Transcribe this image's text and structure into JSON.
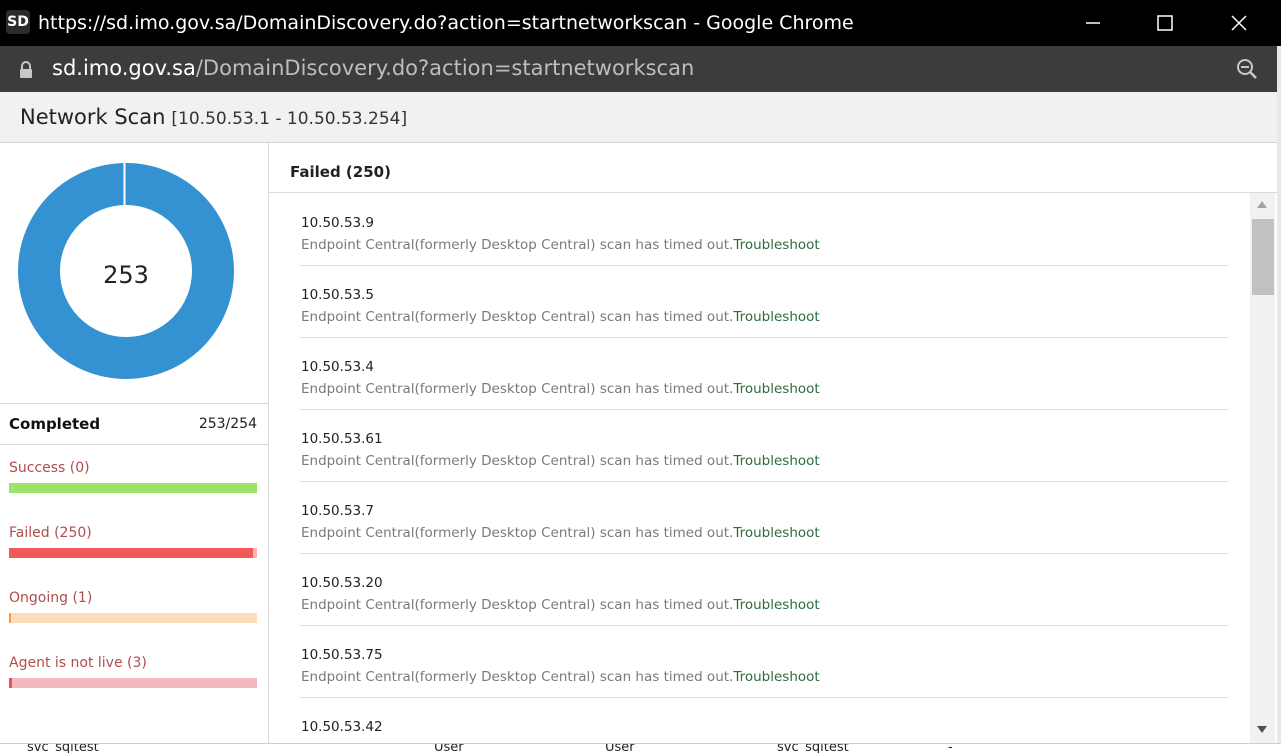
{
  "window": {
    "app_icon_text": "SD",
    "title": "https://sd.imo.gov.sa/DomainDiscovery.do?action=startnetworkscan - Google Chrome"
  },
  "address_bar": {
    "domain": "sd.imo.gov.sa",
    "path": "/DomainDiscovery.do?action=startnetworkscan"
  },
  "dialog": {
    "title": "Network Scan",
    "range": "[10.50.53.1 - 10.50.53.254]"
  },
  "summary": {
    "donut_total": "253",
    "completed_label": "Completed",
    "completed_value": "253/254",
    "stats": [
      {
        "label": "Success (0)",
        "fraction": 1.0,
        "color": "#9de36a"
      },
      {
        "label": "Failed (250)",
        "fraction": 0.984,
        "color": "#f25a5a",
        "track": "#f9b3b3"
      },
      {
        "label": "Ongoing (1)",
        "fraction": 0.004,
        "color": "#e8a14a",
        "track": "#fddcb9"
      },
      {
        "label": "Agent is not live (3)",
        "fraction": 0.012,
        "color": "#e85555",
        "track": "#f4b9bd"
      }
    ],
    "colors": {
      "donut": "#3592d2",
      "donut_gap": "#ffffff"
    }
  },
  "failed": {
    "heading": "Failed (250)",
    "items": [
      {
        "ip": "10.50.53.9",
        "message": "Endpoint Central(formerly Desktop Central) scan has timed out.",
        "link": "Troubleshoot"
      },
      {
        "ip": "10.50.53.5",
        "message": "Endpoint Central(formerly Desktop Central) scan has timed out.",
        "link": "Troubleshoot"
      },
      {
        "ip": "10.50.53.4",
        "message": "Endpoint Central(formerly Desktop Central) scan has timed out.",
        "link": "Troubleshoot"
      },
      {
        "ip": "10.50.53.61",
        "message": "Endpoint Central(formerly Desktop Central) scan has timed out.",
        "link": "Troubleshoot"
      },
      {
        "ip": "10.50.53.7",
        "message": "Endpoint Central(formerly Desktop Central) scan has timed out.",
        "link": "Troubleshoot"
      },
      {
        "ip": "10.50.53.20",
        "message": "Endpoint Central(formerly Desktop Central) scan has timed out.",
        "link": "Troubleshoot"
      },
      {
        "ip": "10.50.53.75",
        "message": "Endpoint Central(formerly Desktop Central) scan has timed out.",
        "link": "Troubleshoot"
      },
      {
        "ip": "10.50.53.42",
        "message": "",
        "link": ""
      }
    ]
  },
  "background_row": {
    "cells": [
      "svc_sqltest",
      "User",
      "User",
      "svc_sqltest",
      "-"
    ]
  }
}
